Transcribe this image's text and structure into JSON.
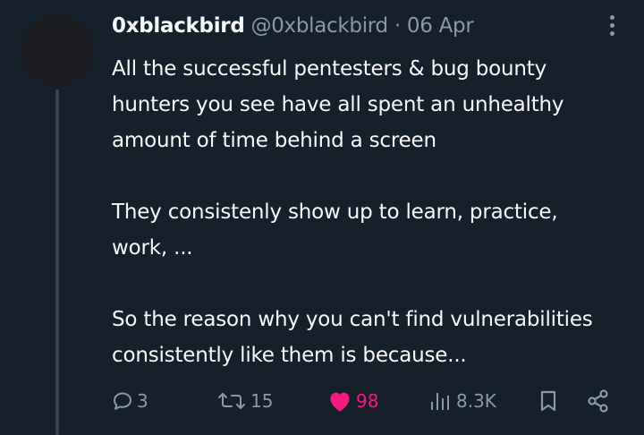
{
  "tweet": {
    "display_name": "0xblackbird",
    "handle": "@0xblackbird",
    "separator": "·",
    "date": "06 Apr",
    "lines": [
      "All the successful pentesters & bug bounty",
      "hunters you see have all spent an unhealthy",
      "amount of time behind a screen",
      "They consistenly show up to learn, practice,",
      "work, ...",
      "So the reason why you can't find vulnerabilities",
      "consistently like them is because..."
    ]
  },
  "actions": {
    "replies": "3",
    "retweets": "15",
    "likes": "98",
    "views": "8.3K"
  },
  "icons": {
    "reply": "reply-icon",
    "retweet": "retweet-icon",
    "like": "heart-icon",
    "views": "views-icon",
    "bookmark": "bookmark-icon",
    "share": "share-icon",
    "more": "more-vertical-icon"
  },
  "colors": {
    "background": "#15202b",
    "text": "#f7f9f9",
    "muted": "#8b98a5",
    "like": "#f91880"
  }
}
